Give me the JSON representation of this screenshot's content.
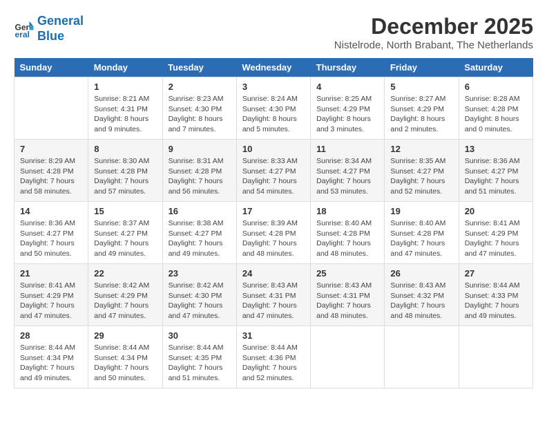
{
  "logo": {
    "line1": "General",
    "line2": "Blue"
  },
  "title": "December 2025",
  "subtitle": "Nistelrode, North Brabant, The Netherlands",
  "days_of_week": [
    "Sunday",
    "Monday",
    "Tuesday",
    "Wednesday",
    "Thursday",
    "Friday",
    "Saturday"
  ],
  "weeks": [
    [
      {
        "day": null,
        "sunrise": null,
        "sunset": null,
        "daylight": null
      },
      {
        "day": "1",
        "sunrise": "Sunrise: 8:21 AM",
        "sunset": "Sunset: 4:31 PM",
        "daylight": "Daylight: 8 hours and 9 minutes."
      },
      {
        "day": "2",
        "sunrise": "Sunrise: 8:23 AM",
        "sunset": "Sunset: 4:30 PM",
        "daylight": "Daylight: 8 hours and 7 minutes."
      },
      {
        "day": "3",
        "sunrise": "Sunrise: 8:24 AM",
        "sunset": "Sunset: 4:30 PM",
        "daylight": "Daylight: 8 hours and 5 minutes."
      },
      {
        "day": "4",
        "sunrise": "Sunrise: 8:25 AM",
        "sunset": "Sunset: 4:29 PM",
        "daylight": "Daylight: 8 hours and 3 minutes."
      },
      {
        "day": "5",
        "sunrise": "Sunrise: 8:27 AM",
        "sunset": "Sunset: 4:29 PM",
        "daylight": "Daylight: 8 hours and 2 minutes."
      },
      {
        "day": "6",
        "sunrise": "Sunrise: 8:28 AM",
        "sunset": "Sunset: 4:28 PM",
        "daylight": "Daylight: 8 hours and 0 minutes."
      }
    ],
    [
      {
        "day": "7",
        "sunrise": "Sunrise: 8:29 AM",
        "sunset": "Sunset: 4:28 PM",
        "daylight": "Daylight: 7 hours and 58 minutes."
      },
      {
        "day": "8",
        "sunrise": "Sunrise: 8:30 AM",
        "sunset": "Sunset: 4:28 PM",
        "daylight": "Daylight: 7 hours and 57 minutes."
      },
      {
        "day": "9",
        "sunrise": "Sunrise: 8:31 AM",
        "sunset": "Sunset: 4:28 PM",
        "daylight": "Daylight: 7 hours and 56 minutes."
      },
      {
        "day": "10",
        "sunrise": "Sunrise: 8:33 AM",
        "sunset": "Sunset: 4:27 PM",
        "daylight": "Daylight: 7 hours and 54 minutes."
      },
      {
        "day": "11",
        "sunrise": "Sunrise: 8:34 AM",
        "sunset": "Sunset: 4:27 PM",
        "daylight": "Daylight: 7 hours and 53 minutes."
      },
      {
        "day": "12",
        "sunrise": "Sunrise: 8:35 AM",
        "sunset": "Sunset: 4:27 PM",
        "daylight": "Daylight: 7 hours and 52 minutes."
      },
      {
        "day": "13",
        "sunrise": "Sunrise: 8:36 AM",
        "sunset": "Sunset: 4:27 PM",
        "daylight": "Daylight: 7 hours and 51 minutes."
      }
    ],
    [
      {
        "day": "14",
        "sunrise": "Sunrise: 8:36 AM",
        "sunset": "Sunset: 4:27 PM",
        "daylight": "Daylight: 7 hours and 50 minutes."
      },
      {
        "day": "15",
        "sunrise": "Sunrise: 8:37 AM",
        "sunset": "Sunset: 4:27 PM",
        "daylight": "Daylight: 7 hours and 49 minutes."
      },
      {
        "day": "16",
        "sunrise": "Sunrise: 8:38 AM",
        "sunset": "Sunset: 4:27 PM",
        "daylight": "Daylight: 7 hours and 49 minutes."
      },
      {
        "day": "17",
        "sunrise": "Sunrise: 8:39 AM",
        "sunset": "Sunset: 4:28 PM",
        "daylight": "Daylight: 7 hours and 48 minutes."
      },
      {
        "day": "18",
        "sunrise": "Sunrise: 8:40 AM",
        "sunset": "Sunset: 4:28 PM",
        "daylight": "Daylight: 7 hours and 48 minutes."
      },
      {
        "day": "19",
        "sunrise": "Sunrise: 8:40 AM",
        "sunset": "Sunset: 4:28 PM",
        "daylight": "Daylight: 7 hours and 47 minutes."
      },
      {
        "day": "20",
        "sunrise": "Sunrise: 8:41 AM",
        "sunset": "Sunset: 4:29 PM",
        "daylight": "Daylight: 7 hours and 47 minutes."
      }
    ],
    [
      {
        "day": "21",
        "sunrise": "Sunrise: 8:41 AM",
        "sunset": "Sunset: 4:29 PM",
        "daylight": "Daylight: 7 hours and 47 minutes."
      },
      {
        "day": "22",
        "sunrise": "Sunrise: 8:42 AM",
        "sunset": "Sunset: 4:29 PM",
        "daylight": "Daylight: 7 hours and 47 minutes."
      },
      {
        "day": "23",
        "sunrise": "Sunrise: 8:42 AM",
        "sunset": "Sunset: 4:30 PM",
        "daylight": "Daylight: 7 hours and 47 minutes."
      },
      {
        "day": "24",
        "sunrise": "Sunrise: 8:43 AM",
        "sunset": "Sunset: 4:31 PM",
        "daylight": "Daylight: 7 hours and 47 minutes."
      },
      {
        "day": "25",
        "sunrise": "Sunrise: 8:43 AM",
        "sunset": "Sunset: 4:31 PM",
        "daylight": "Daylight: 7 hours and 48 minutes."
      },
      {
        "day": "26",
        "sunrise": "Sunrise: 8:43 AM",
        "sunset": "Sunset: 4:32 PM",
        "daylight": "Daylight: 7 hours and 48 minutes."
      },
      {
        "day": "27",
        "sunrise": "Sunrise: 8:44 AM",
        "sunset": "Sunset: 4:33 PM",
        "daylight": "Daylight: 7 hours and 49 minutes."
      }
    ],
    [
      {
        "day": "28",
        "sunrise": "Sunrise: 8:44 AM",
        "sunset": "Sunset: 4:34 PM",
        "daylight": "Daylight: 7 hours and 49 minutes."
      },
      {
        "day": "29",
        "sunrise": "Sunrise: 8:44 AM",
        "sunset": "Sunset: 4:34 PM",
        "daylight": "Daylight: 7 hours and 50 minutes."
      },
      {
        "day": "30",
        "sunrise": "Sunrise: 8:44 AM",
        "sunset": "Sunset: 4:35 PM",
        "daylight": "Daylight: 7 hours and 51 minutes."
      },
      {
        "day": "31",
        "sunrise": "Sunrise: 8:44 AM",
        "sunset": "Sunset: 4:36 PM",
        "daylight": "Daylight: 7 hours and 52 minutes."
      },
      {
        "day": null,
        "sunrise": null,
        "sunset": null,
        "daylight": null
      },
      {
        "day": null,
        "sunrise": null,
        "sunset": null,
        "daylight": null
      },
      {
        "day": null,
        "sunrise": null,
        "sunset": null,
        "daylight": null
      }
    ]
  ]
}
